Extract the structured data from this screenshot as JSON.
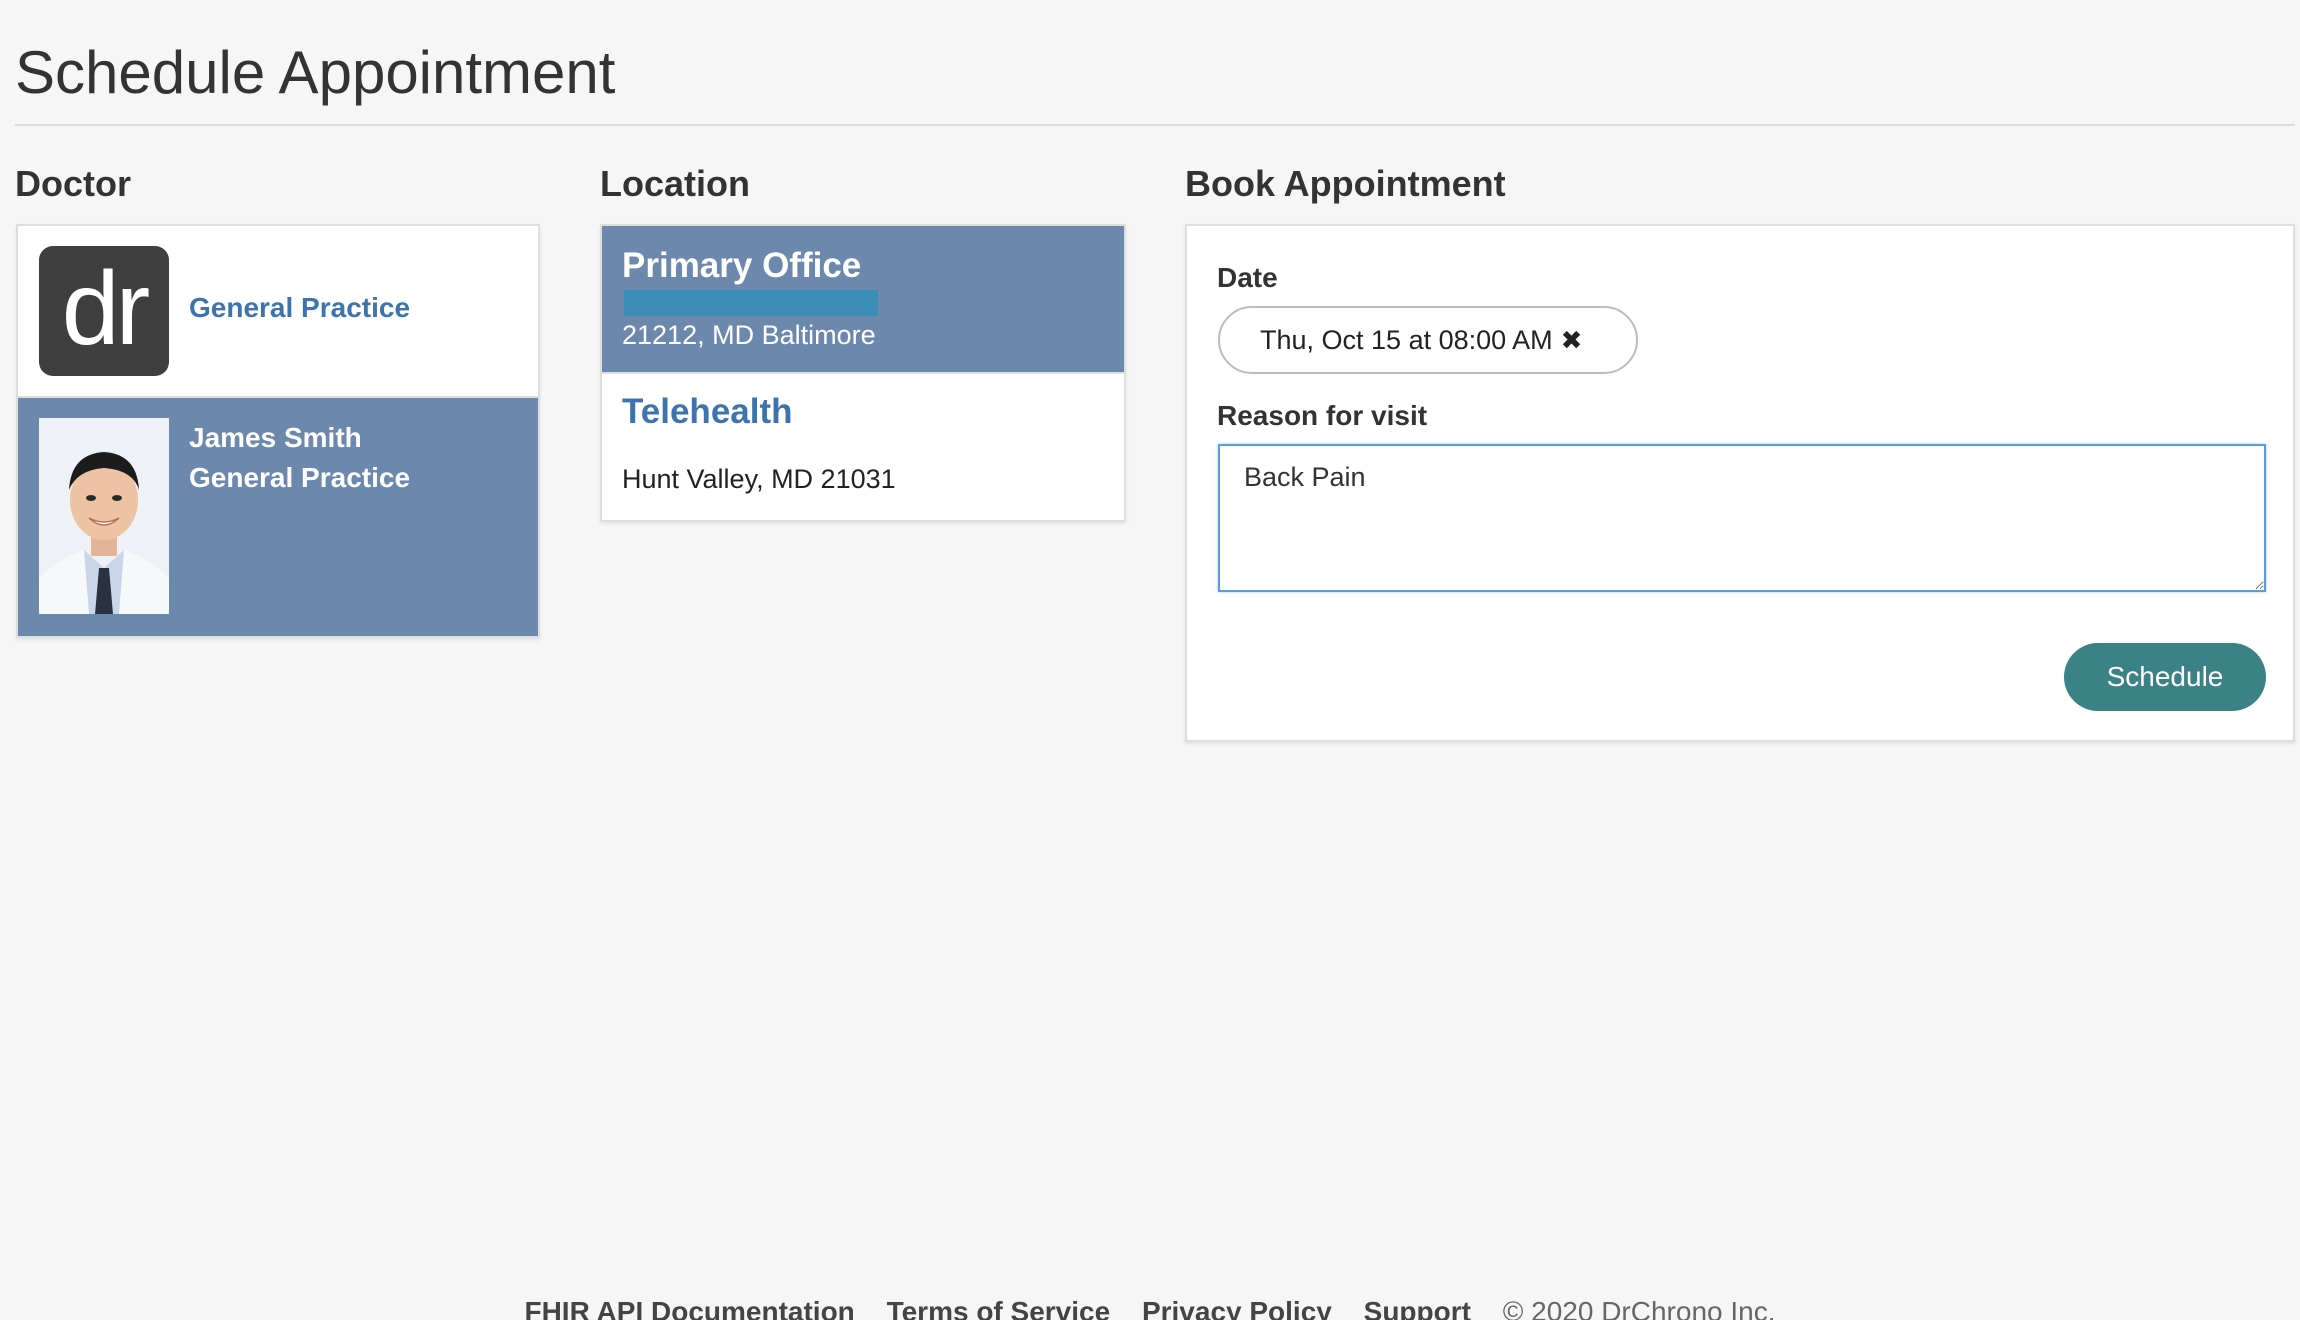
{
  "page": {
    "title": "Schedule Appointment"
  },
  "doctor": {
    "heading": "Doctor",
    "practice": {
      "logo_text": "dr",
      "label": "General Practice"
    },
    "selected_doctor": {
      "name": "James Smith",
      "specialty": "General Practice",
      "avatar_icon": "doctor-photo"
    }
  },
  "location": {
    "heading": "Location",
    "items": [
      {
        "name": "Primary Office",
        "address": "21212, MD Baltimore",
        "selected": true
      },
      {
        "name": "Telehealth",
        "address": "Hunt Valley, MD 21031",
        "selected": false
      }
    ]
  },
  "book": {
    "heading": "Book Appointment",
    "date_label": "Date",
    "date_value": "Thu, Oct 15 at 08:00 AM",
    "reason_label": "Reason for visit",
    "reason_value": "Back Pain",
    "schedule_label": "Schedule"
  },
  "footer": {
    "links": [
      "FHIR API Documentation",
      "Terms of Service",
      "Privacy Policy",
      "Support"
    ],
    "copyright": "© 2020 DrChrono Inc."
  },
  "colors": {
    "selected_bg": "#6d88ad",
    "link_blue": "#3d73ae",
    "button_teal": "#3a8286"
  }
}
